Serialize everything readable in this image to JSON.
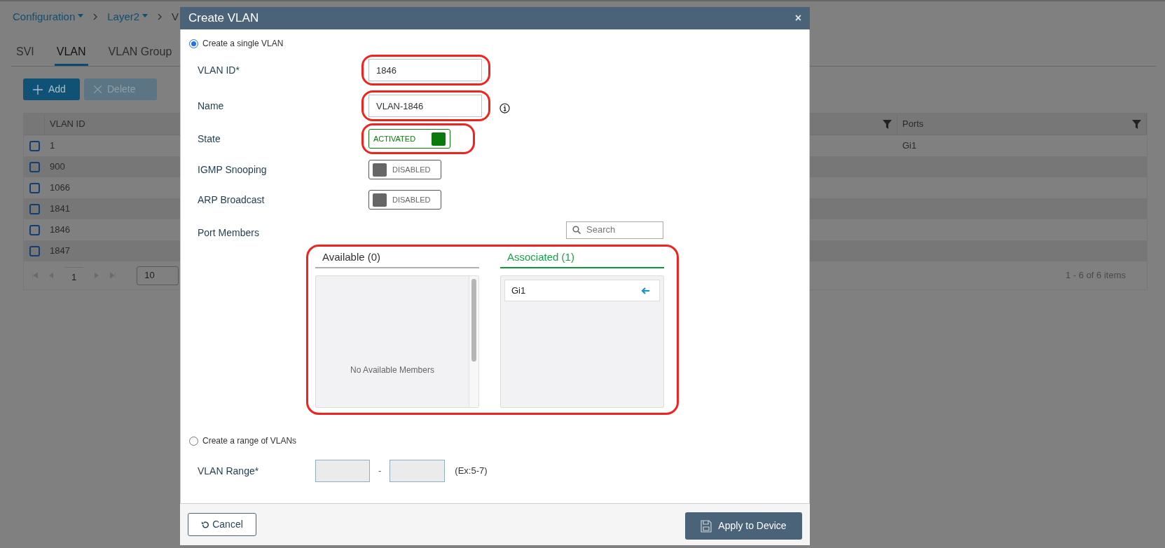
{
  "breadcrumb": [
    {
      "label": "Configuration",
      "dropdown": true
    },
    {
      "label": "Layer2",
      "dropdown": true
    },
    {
      "label": "V",
      "dropdown": false
    }
  ],
  "tabs": [
    {
      "label": "SVI",
      "selected": false
    },
    {
      "label": "VLAN",
      "selected": true
    },
    {
      "label": "VLAN Group",
      "selected": false
    }
  ],
  "toolbar": [
    {
      "label": "Add",
      "kind": "add",
      "disabled": false
    },
    {
      "label": "Delete",
      "kind": "delete",
      "disabled": true
    }
  ],
  "table": {
    "columns": [
      {
        "label": "VLAN ID",
        "filter": false
      },
      {
        "filter": true
      },
      {
        "label": "Ports",
        "filter": true
      }
    ],
    "rows": [
      {
        "checked": false,
        "vlan_id": "1",
        "ports": "Gi1"
      },
      {
        "checked": false,
        "vlan_id": "900"
      },
      {
        "checked": false,
        "vlan_id": "1066"
      },
      {
        "checked": false,
        "vlan_id": "1841"
      },
      {
        "checked": false,
        "vlan_id": "1846"
      },
      {
        "checked": false,
        "vlan_id": "1847"
      }
    ],
    "pager": {
      "page": "1",
      "page_size": "10",
      "summary": "1 - 6 of 6 items"
    }
  },
  "dialog": {
    "title": "Create VLAN",
    "close": "×",
    "options": [
      {
        "label": "Create a single VLAN",
        "selected": true
      },
      {
        "label": "Create a range of VLANs",
        "selected": false
      }
    ],
    "fields": [
      {
        "label": "VLAN ID*",
        "kind": "input",
        "value": "1846",
        "highlighted": true
      },
      {
        "label": "Name",
        "kind": "input",
        "value": "VLAN-1846",
        "info": true,
        "highlighted": true
      },
      {
        "label": "State",
        "kind": "toggle",
        "on": true,
        "text": "ACTIVATED",
        "highlighted": true
      },
      {
        "label": "IGMP Snooping",
        "kind": "toggle",
        "on": false,
        "text": "DISABLED",
        "highlighted": false
      },
      {
        "label": "ARP Broadcast",
        "kind": "toggle",
        "on": false,
        "text": "DISABLED",
        "highlighted": false
      }
    ],
    "port_members": {
      "label": "Port Members",
      "search_placeholder": "Search",
      "highlighted": true,
      "panes": [
        {
          "title": "Available (0)",
          "selected": false,
          "empty_text": "No Available Members"
        },
        {
          "title": "Associated (1)",
          "selected": true,
          "items": [
            "Gi1"
          ]
        }
      ]
    },
    "range": {
      "label": "VLAN Range*",
      "separator": "-",
      "hint": "(Ex:5-7)"
    },
    "buttons": [
      {
        "label": "Cancel",
        "kind": "cancel"
      },
      {
        "label": "Apply to Device",
        "kind": "apply"
      }
    ]
  }
}
